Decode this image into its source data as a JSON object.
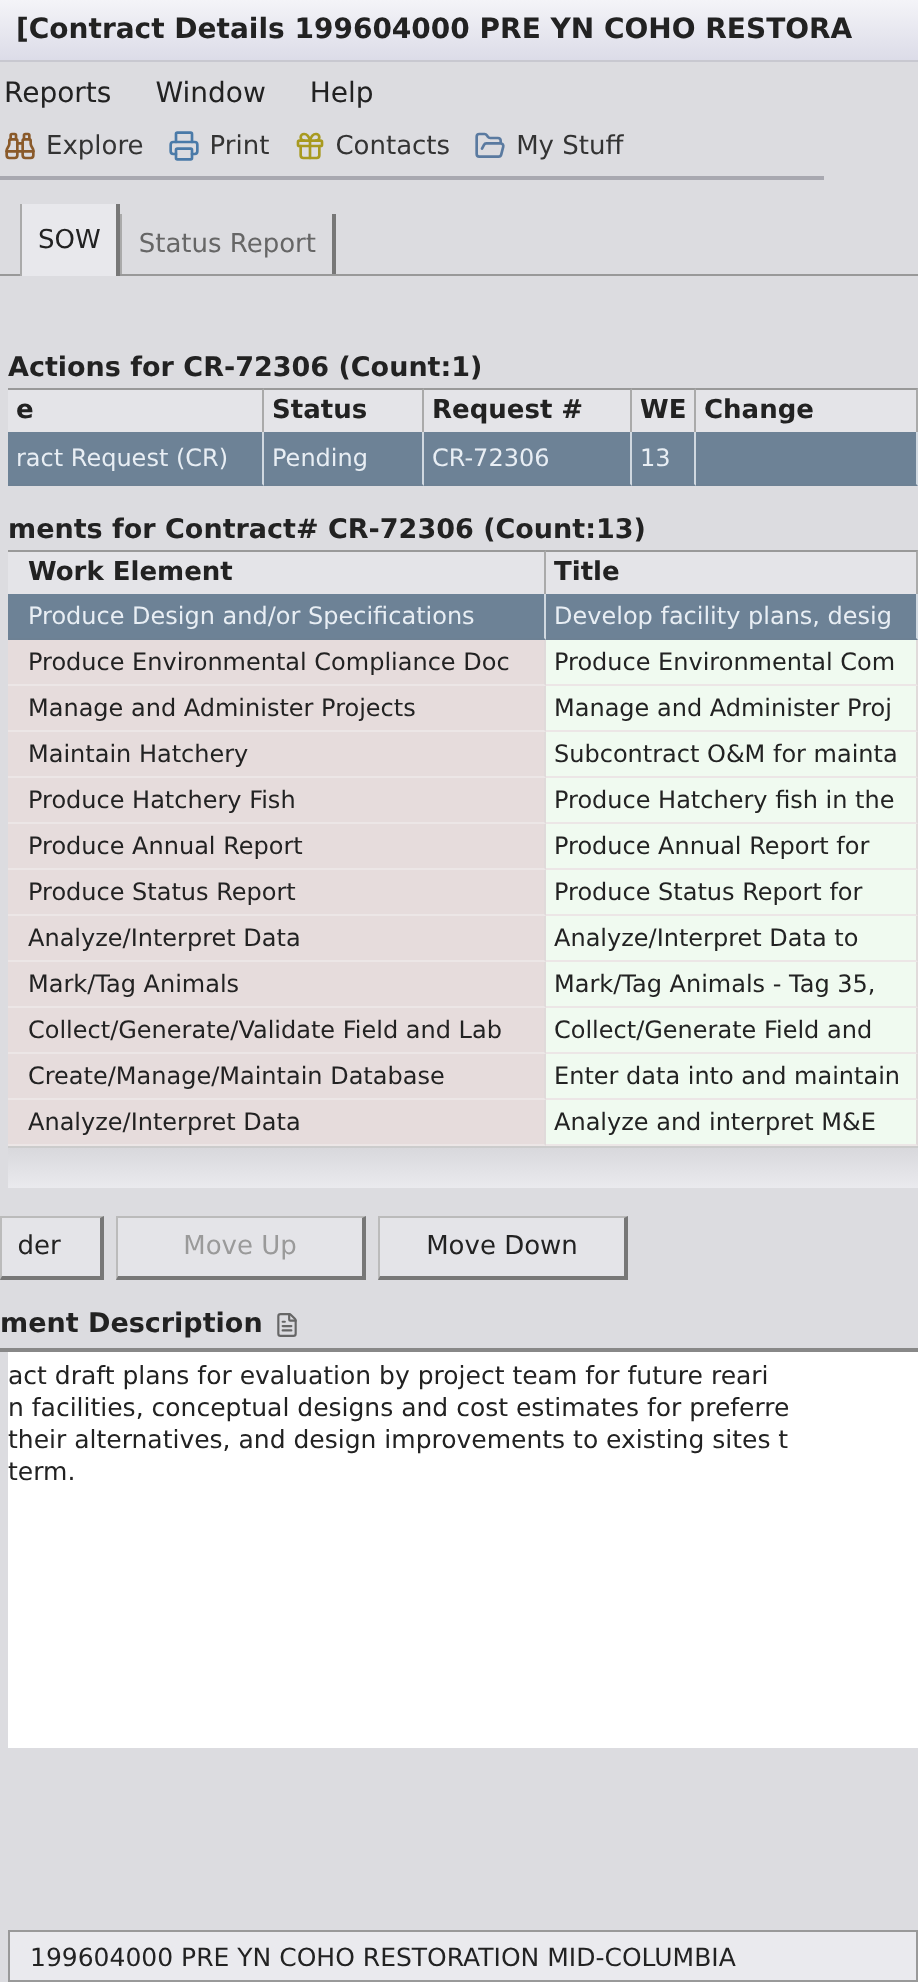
{
  "window": {
    "title": "[Contract Details   199604000 PRE YN COHO RESTORA"
  },
  "menu": [
    {
      "label": "Reports"
    },
    {
      "label": "Window"
    },
    {
      "label": "Help"
    }
  ],
  "toolbar": [
    {
      "label": "Explore",
      "kind": "binoculars"
    },
    {
      "label": "Print",
      "kind": "printer"
    },
    {
      "label": "Contacts",
      "kind": "gift"
    },
    {
      "label": "My Stuff",
      "kind": "folder"
    }
  ],
  "tabs": [
    {
      "label": "SOW",
      "selected": true
    },
    {
      "label": "Status Report",
      "selected": false
    }
  ],
  "actions": {
    "heading": "Actions for CR-72306 (Count:1)",
    "columns": [
      "e",
      "Status",
      "Request #",
      "WE",
      "Change"
    ],
    "rows": [
      {
        "cells": [
          "ract Request (CR)",
          "Pending",
          "CR-72306",
          "13"
        ],
        "selected": true
      }
    ]
  },
  "work_elements": {
    "heading": "ments for Contract# CR-72306 (Count:13)",
    "columns": [
      "Work Element",
      "Title"
    ],
    "rows": [
      {
        "cells": [
          "Produce Design and/or Specifications",
          "Develop facility plans, desig"
        ],
        "selected": true
      },
      {
        "cells": [
          "Produce Environmental Compliance Doc",
          "Produce Environmental Com"
        ],
        "selected": false
      },
      {
        "cells": [
          "Manage and Administer Projects",
          "Manage and Administer Proj"
        ],
        "selected": false
      },
      {
        "cells": [
          "Maintain Hatchery",
          "Subcontract O&M for mainta"
        ],
        "selected": false
      },
      {
        "cells": [
          "Produce Hatchery Fish",
          "Produce Hatchery fish in the"
        ],
        "selected": false
      },
      {
        "cells": [
          "Produce Annual Report",
          "Produce Annual Report for"
        ],
        "selected": false
      },
      {
        "cells": [
          "Produce Status Report",
          "Produce Status Report for"
        ],
        "selected": false
      },
      {
        "cells": [
          "Analyze/Interpret Data",
          "Analyze/Interpret Data to"
        ],
        "selected": false
      },
      {
        "cells": [
          "Mark/Tag Animals",
          "Mark/Tag Animals - Tag 35,"
        ],
        "selected": false
      },
      {
        "cells": [
          "Collect/Generate/Validate Field and Lab",
          "Collect/Generate Field and"
        ],
        "selected": false
      },
      {
        "cells": [
          "Create/Manage/Maintain Database",
          "Enter data into and maintain"
        ],
        "selected": false
      },
      {
        "cells": [
          "Analyze/Interpret Data",
          "Analyze and interpret M&E"
        ],
        "selected": false
      }
    ]
  },
  "buttons": [
    {
      "label": "der",
      "disabled": false
    },
    {
      "label": "Move Up",
      "disabled": true
    },
    {
      "label": "Move Down",
      "disabled": false
    }
  ],
  "description": {
    "heading": "ment Description",
    "lines": [
      "act draft plans for evaluation by project team for future reari",
      "n facilities, conceptual designs and cost estimates for preferre",
      "their alternatives, and design improvements to existing sites t",
      "term."
    ]
  },
  "status_bar": "199604000 PRE YN COHO RESTORATION MID-COLUMBIA"
}
